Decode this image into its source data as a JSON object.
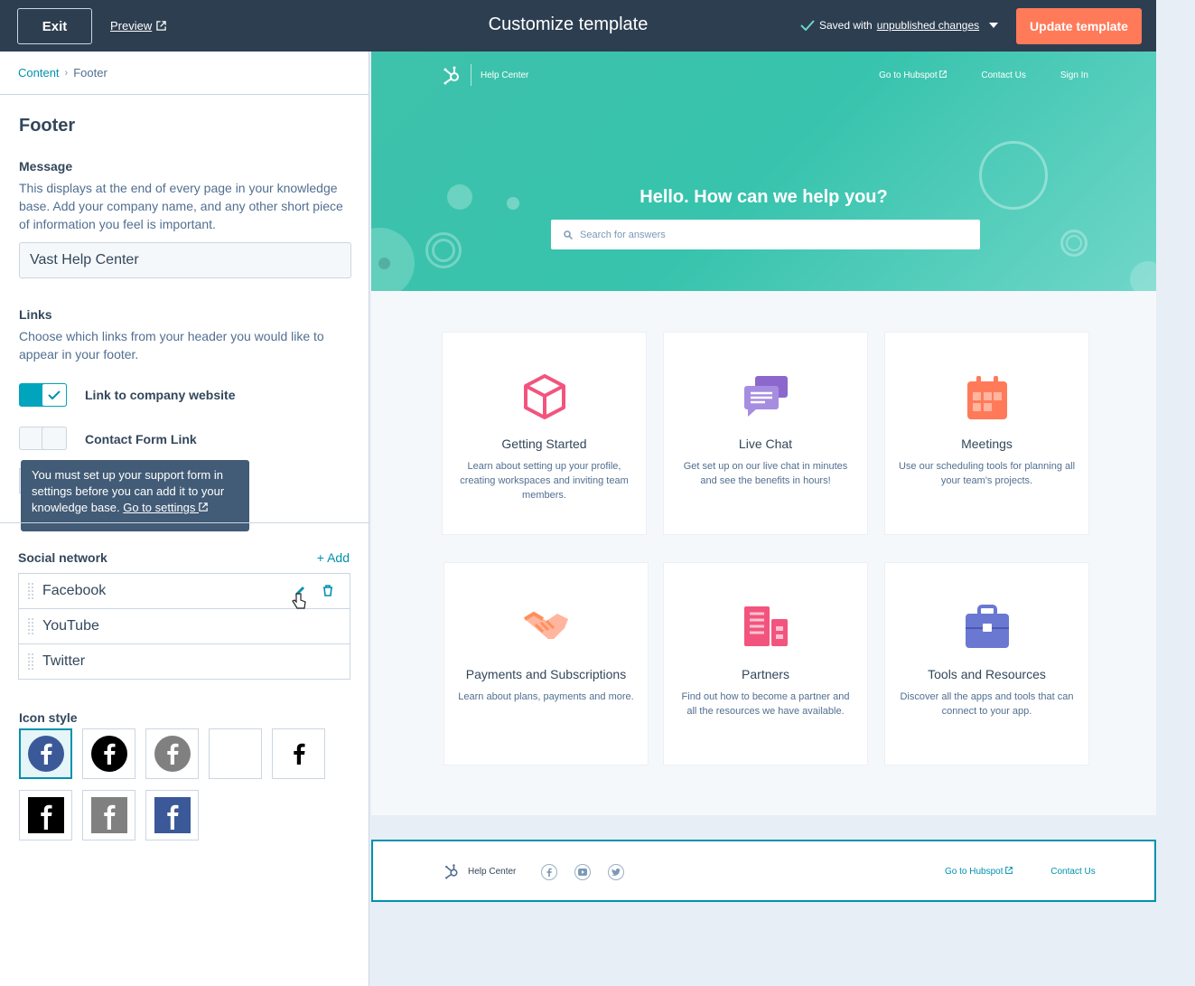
{
  "topbar": {
    "exit_label": "Exit",
    "preview_label": "Preview",
    "title": "Customize template",
    "saved_prefix": "Saved with",
    "saved_link": "unpublished changes",
    "update_label": "Update template"
  },
  "breadcrumb": {
    "parent": "Content",
    "current": "Footer"
  },
  "panel": {
    "title": "Footer",
    "message": {
      "label": "Message",
      "description": "This displays at the end of every page in your knowledge base. Add your company name, and any other short piece of information you feel is important.",
      "value": "Vast Help Center"
    },
    "links": {
      "label": "Links",
      "description": "Choose which links from your header you would like to appear in your footer.",
      "toggles": [
        {
          "label": "Link to company website",
          "on": true
        },
        {
          "label": "Contact Form Link",
          "on": false
        }
      ]
    },
    "tooltip": {
      "text": "You must set up your support form in settings before you can add it to your knowledge base.",
      "link": "Go to settings"
    },
    "social": {
      "label": "Social network",
      "add_label": "+ Add",
      "items": [
        "Facebook",
        "YouTube",
        "Twitter"
      ]
    },
    "icon_style": {
      "label": "Icon style",
      "selected_index": 0
    }
  },
  "preview": {
    "nav": {
      "brand": "Help Center",
      "links": [
        "Go to Hubspot",
        "Contact Us",
        "Sign In"
      ]
    },
    "hero_title": "Hello. How can we help you?",
    "search_placeholder": "Search for answers",
    "cards": [
      {
        "title": "Getting Started",
        "desc": "Learn about setting up your profile, creating workspaces and inviting team members.",
        "icon": "cube-icon",
        "color": "#f2547d"
      },
      {
        "title": "Live Chat",
        "desc": "Get set up on our live chat in minutes and see the benefits in hours!",
        "icon": "chat-bubbles-icon",
        "color": "#8c68cd"
      },
      {
        "title": "Meetings",
        "desc": "Use our scheduling tools for planning all your team's projects.",
        "icon": "calendar-icon",
        "color": "#ff7a59"
      },
      {
        "title": "Payments and Subscriptions",
        "desc": "Learn about plans, payments and more.",
        "icon": "handshake-icon",
        "color": "#ff8f59"
      },
      {
        "title": "Partners",
        "desc": "Find out how to become a partner and all the resources we have available.",
        "icon": "buildings-icon",
        "color": "#f2547d"
      },
      {
        "title": "Tools and Resources",
        "desc": "Discover all the apps and tools that can connect to your app.",
        "icon": "briefcase-icon",
        "color": "#6a78d1"
      }
    ],
    "footer": {
      "brand": "Help Center",
      "links": [
        "Go to Hubspot",
        "Contact Us"
      ]
    }
  },
  "colors": {
    "accent": "#0091ae",
    "topbar": "#2d3e50",
    "cta": "#ff7a59",
    "hero": "#3ec2ab"
  }
}
